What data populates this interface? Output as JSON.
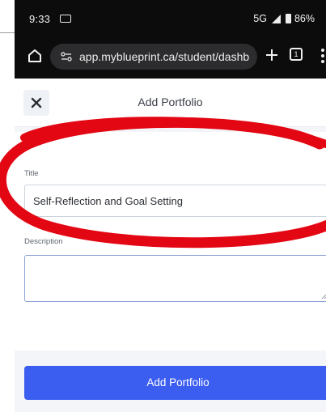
{
  "status_bar": {
    "time": "9:33",
    "network": "5G",
    "battery": "86%"
  },
  "browser": {
    "url": "app.myblueprint.ca/student/dashb"
  },
  "dialog": {
    "title": "Add Portfolio",
    "close_icon": "close-icon",
    "title_field": {
      "label": "Title",
      "value": "Self-Reflection and Goal Setting"
    },
    "description_field": {
      "label": "Description",
      "value": ""
    },
    "submit_label": "Add Portfolio"
  },
  "colors": {
    "primary": "#3b5df0",
    "annotation": "#e30613",
    "header_bg": "#0c0c0c"
  }
}
